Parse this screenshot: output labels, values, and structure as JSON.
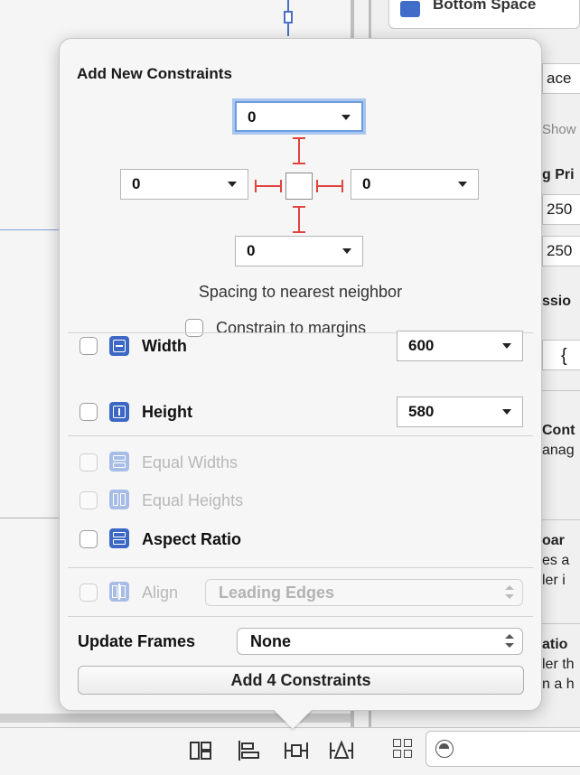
{
  "inspector": {
    "top_card_title": "Bottom Space",
    "frag_ace": "ace",
    "frag_show": "Show",
    "frag_pri": "g Pri",
    "frag_250a": "250",
    "frag_250b": "250",
    "frag_ssio": "ssio",
    "frag_brace": "{",
    "frag_cont": "Cont",
    "frag_anag": "anag",
    "frag_oar": "oar",
    "frag_sa": "es a",
    "frag_ler_i": "ler i",
    "frag_atio": "atio",
    "frag_ler_th": "ler th",
    "frag_ah": "n a h"
  },
  "popover": {
    "title": "Add New Constraints",
    "spacing": {
      "top": "0",
      "left": "0",
      "right": "0",
      "bottom": "0",
      "label": "Spacing to nearest neighbor"
    },
    "constrain_to_margins": "Constrain to margins",
    "width": {
      "label": "Width",
      "value": "600"
    },
    "height": {
      "label": "Height",
      "value": "580"
    },
    "equal_widths": "Equal Widths",
    "equal_heights": "Equal Heights",
    "aspect_ratio": "Aspect Ratio",
    "align": {
      "label": "Align",
      "value": "Leading Edges"
    },
    "update_frames": {
      "label": "Update Frames",
      "value": "None"
    },
    "add_button": "Add 4 Constraints"
  },
  "toolbar": {
    "icons": [
      "stack-icon",
      "align-icon",
      "pin-icon",
      "resolve-icon"
    ]
  }
}
